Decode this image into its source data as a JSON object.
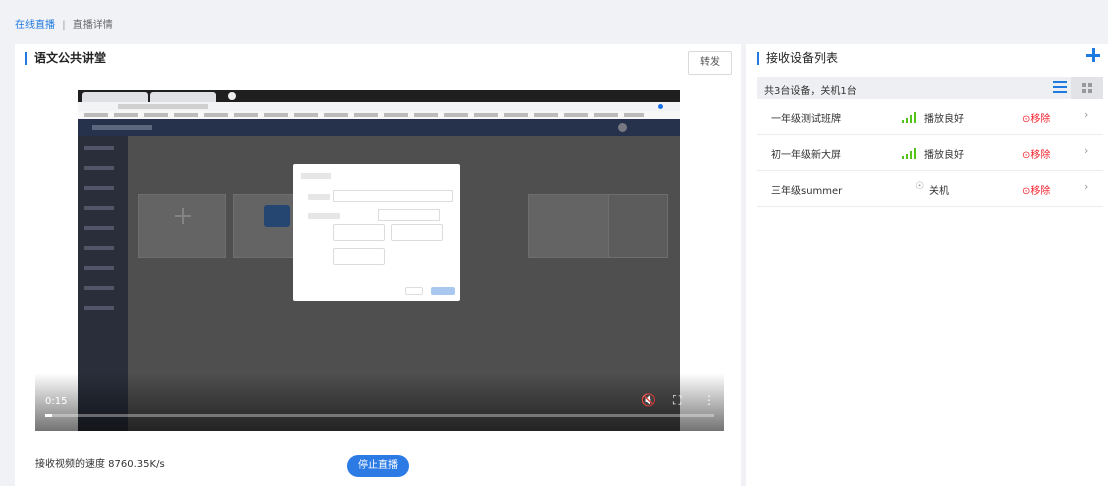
{
  "breadcrumb": {
    "link": "在线直播",
    "separator": "|",
    "current": "直播详情"
  },
  "live": {
    "title": "语文公共讲堂",
    "forward_label": "转发",
    "video": {
      "time": "0:15",
      "progress_percent": 1
    },
    "speed_text": "接收视频的速度 8760.35K/s",
    "stop_label": "停止直播"
  },
  "devices": {
    "title": "接收设备列表",
    "summary": "共3台设备，关机1台",
    "remove_label": "移除",
    "items": [
      {
        "name": "一年级测试班牌",
        "status": "播放良好",
        "signal": true
      },
      {
        "name": "初一年级新大屏",
        "status": "播放良好",
        "signal": true
      },
      {
        "name": "三年级summer",
        "status": "关机",
        "signal": false
      }
    ]
  },
  "colors": {
    "accent": "#1f7ae0",
    "good": "#52c41a",
    "danger": "#f5222d",
    "button": "#2c7be5"
  }
}
